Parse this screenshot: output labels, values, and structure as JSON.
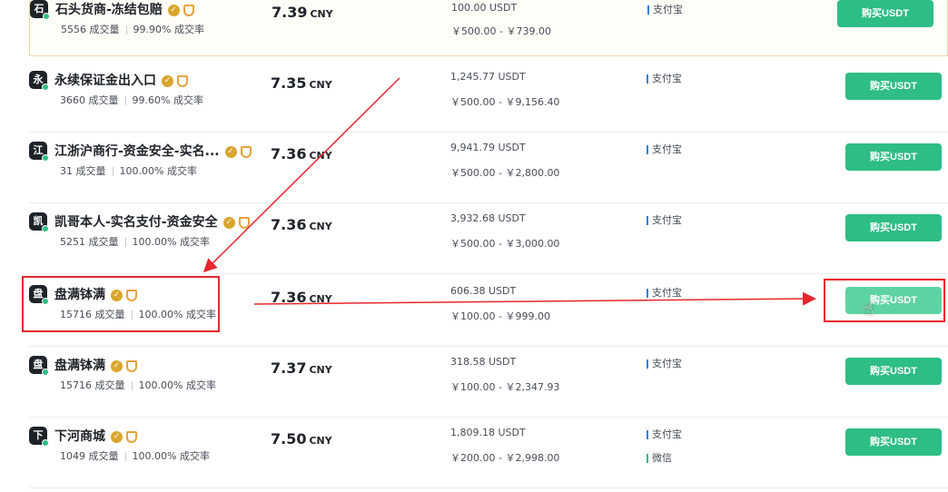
{
  "currency_label": "CNY",
  "buy_label": "购买USDT",
  "stat_volume_suffix": "成交量",
  "stat_rate_suffix": "成交率",
  "sellers": [
    {
      "avatar": "石",
      "name": "石头货商-冻结包赔",
      "orders": "5556",
      "rate": "99.90%",
      "price": "7.39",
      "available": "100.00 USDT",
      "limit": "￥500.00 - ￥739.00",
      "pay": [
        "支付宝"
      ]
    },
    {
      "avatar": "永",
      "name": "永续保证金出入口",
      "orders": "3660",
      "rate": "99.60%",
      "price": "7.35",
      "available": "1,245.77 USDT",
      "limit": "￥500.00 - ￥9,156.40",
      "pay": [
        "支付宝"
      ]
    },
    {
      "avatar": "江",
      "name": "江浙沪商行-资金安全-实名...",
      "orders": "31",
      "rate": "100.00%",
      "price": "7.36",
      "available": "9,941.79 USDT",
      "limit": "￥500.00 - ￥2,800.00",
      "pay": [
        "支付宝"
      ]
    },
    {
      "avatar": "凯",
      "name": "凯哥本人-实名支付-资金安全",
      "orders": "5251",
      "rate": "100.00%",
      "price": "7.36",
      "available": "3,932.68 USDT",
      "limit": "￥500.00 - ￥3,000.00",
      "pay": [
        "支付宝"
      ]
    },
    {
      "avatar": "盘",
      "name": "盘满钵满",
      "orders": "15716",
      "rate": "100.00%",
      "price": "7.36",
      "available": "606.38 USDT",
      "limit": "￥100.00 - ￥999.00",
      "pay": [
        "支付宝"
      ]
    },
    {
      "avatar": "盘",
      "name": "盘满钵满",
      "orders": "15716",
      "rate": "100.00%",
      "price": "7.37",
      "available": "318.58 USDT",
      "limit": "￥100.00 - ￥2,347.93",
      "pay": [
        "支付宝"
      ]
    },
    {
      "avatar": "下",
      "name": "下河商城",
      "orders": "1049",
      "rate": "100.00%",
      "price": "7.50",
      "available": "1,809.18 USDT",
      "limit": "￥200.00 - ￥2,998.00",
      "pay": [
        "支付宝",
        "微信"
      ]
    }
  ],
  "colors": {
    "buy_green": "#2ebd85",
    "annotation_red": "#e8262b",
    "shield_orange": "#e8a23a"
  }
}
